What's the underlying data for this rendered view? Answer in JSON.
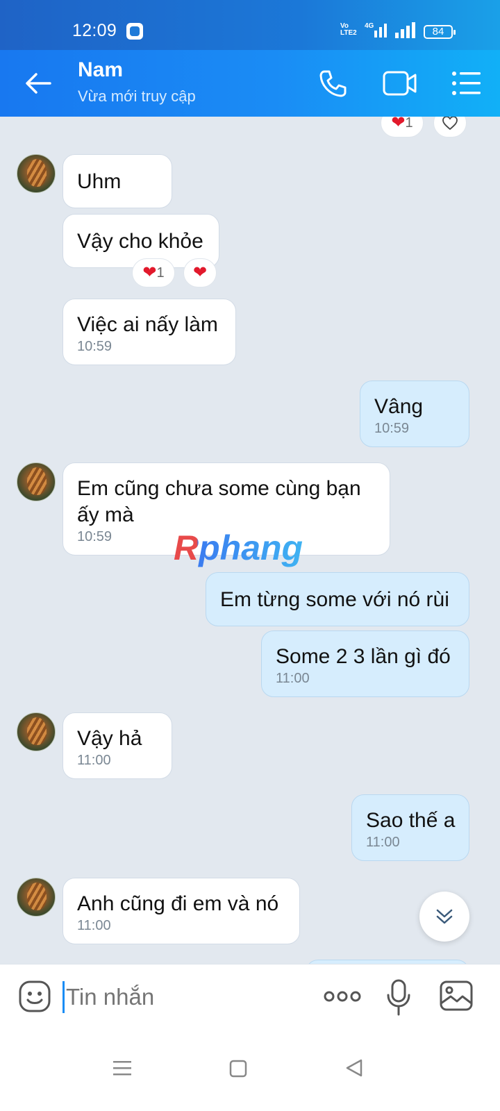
{
  "status_bar": {
    "time": "12:09",
    "network": "4G",
    "volte": "Vo LTE2",
    "battery": "84"
  },
  "header": {
    "contact_name": "Nam",
    "contact_status": "Vừa mới truy cập"
  },
  "top_reaction": {
    "count": "1"
  },
  "messages": [
    {
      "dir": "in",
      "text": "Uhm"
    },
    {
      "dir": "in",
      "text": "Vậy cho khỏe",
      "reaction_count": "1"
    },
    {
      "dir": "in",
      "text": "Việc ai nấy làm",
      "time": "10:59"
    },
    {
      "dir": "out",
      "text": "Vâng",
      "time": "10:59"
    },
    {
      "dir": "in",
      "text_line1": "Em cũng chưa some cùng bạn",
      "text_line2": "ấy mà",
      "time": "10:59"
    },
    {
      "dir": "out",
      "text": "Em từng some với nó rùi"
    },
    {
      "dir": "out",
      "text": "Some 2 3 lần gì đó",
      "time": "11:00"
    },
    {
      "dir": "in",
      "text": "Vậy hả",
      "time": "11:00"
    },
    {
      "dir": "out",
      "text": "Sao thế a",
      "time": "11:00"
    },
    {
      "dir": "in",
      "text": "Anh cũng đi em và nó",
      "time": "11:00"
    }
  ],
  "watermark": "Rphang",
  "input": {
    "placeholder": "Tin nhắn"
  },
  "colors": {
    "header_start": "#1878f0",
    "header_end": "#11b0f7",
    "chat_bg": "#e2e8ef",
    "outgoing_bubble": "#d6edfd",
    "incoming_bubble": "#ffffff",
    "heart": "#e2192c"
  },
  "icons": {
    "back": "arrow-left-icon",
    "call": "phone-icon",
    "video": "video-camera-icon",
    "menu": "list-menu-icon",
    "emoji": "emoji-icon",
    "more": "more-dots-icon",
    "mic": "microphone-icon",
    "image": "image-icon",
    "scroll_down": "chevron-double-down-icon"
  }
}
